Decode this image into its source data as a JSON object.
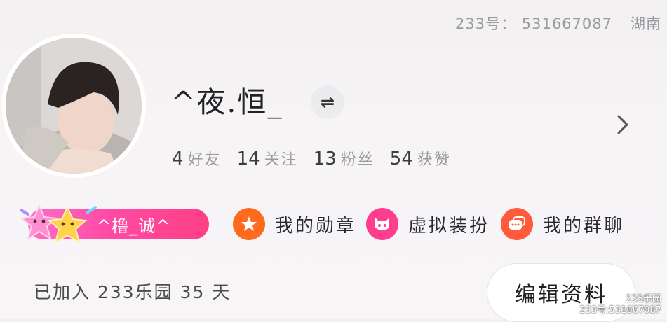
{
  "header": {
    "account_id_text": "233号： 531667087",
    "region": "湖南"
  },
  "profile": {
    "username": "^夜.恒_",
    "switch_icon": "⇌",
    "stats": [
      {
        "count": "4",
        "label": "好友"
      },
      {
        "count": "14",
        "label": "关注"
      },
      {
        "count": "13",
        "label": "粉丝"
      },
      {
        "count": "54",
        "label": "获赞"
      }
    ]
  },
  "badge": {
    "name": "^橹_诚^"
  },
  "features": [
    {
      "label": "我的勋章",
      "icon": "star-badge-icon",
      "color": "#ff6a1f"
    },
    {
      "label": "虚拟装扮",
      "icon": "cat-face-icon",
      "color": "#ff3f8e"
    },
    {
      "label": "我的群聊",
      "icon": "chat-bubbles-icon",
      "color": "#ff5a3c"
    }
  ],
  "footer": {
    "joined_text": "已加入 233乐园 35 天",
    "edit_button": "编辑资料"
  },
  "watermark": {
    "line1": "233乐园",
    "line2": "233号:531667087"
  }
}
